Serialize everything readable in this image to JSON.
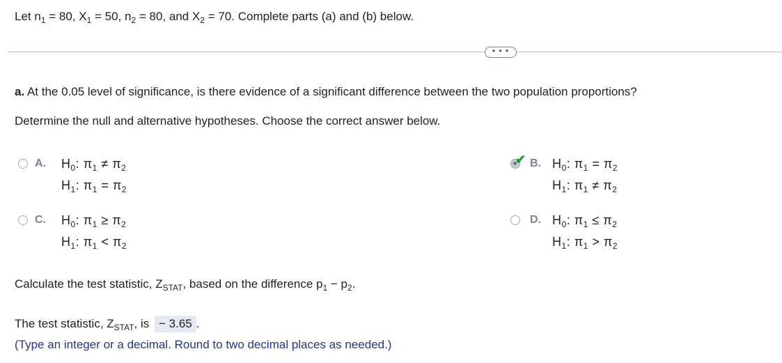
{
  "intro": {
    "prefix": "Let n",
    "n1_val": " = 80, X",
    "x1_val": " = 50, n",
    "n2_val": " = 80, and X",
    "x2_val": " = 70. Complete parts (a) and (b) below.",
    "sub1": "1",
    "sub2": "2"
  },
  "more_button": "• • •",
  "part_a": {
    "label": "a.",
    "question": " At the 0.05 level of significance, is there evidence of a significant difference between the two population proportions?",
    "instruction": "Determine the null and alternative hypotheses. Choose the correct answer below."
  },
  "options": [
    {
      "letter": "A.",
      "h0_rel": "≠",
      "h1_rel": "=",
      "selected": false
    },
    {
      "letter": "B.",
      "h0_rel": "=",
      "h1_rel": "≠",
      "selected": true
    },
    {
      "letter": "C.",
      "h0_rel": "≥",
      "h1_rel": "<",
      "selected": false
    },
    {
      "letter": "D.",
      "h0_rel": "≤",
      "h1_rel": ">",
      "selected": false
    }
  ],
  "hyp": {
    "H": "H",
    "sub0": "0",
    "sub1": "1",
    "pi": "π",
    "pisub1": "1",
    "pisub2": "2"
  },
  "calc": {
    "text_prefix": "Calculate the test statistic, Z",
    "stat_sub": "STAT",
    "text_mid": ", based on the difference p",
    "p_sub1": "1",
    "minus": " − p",
    "p_sub2": "2",
    "end": "."
  },
  "result": {
    "prefix": "The test statistic, Z",
    "stat_sub": "STAT",
    "mid": ", is",
    "value": "− 3.65",
    "end": "."
  },
  "hint": "(Type an integer or a decimal. Round to two decimal places as needed.)"
}
